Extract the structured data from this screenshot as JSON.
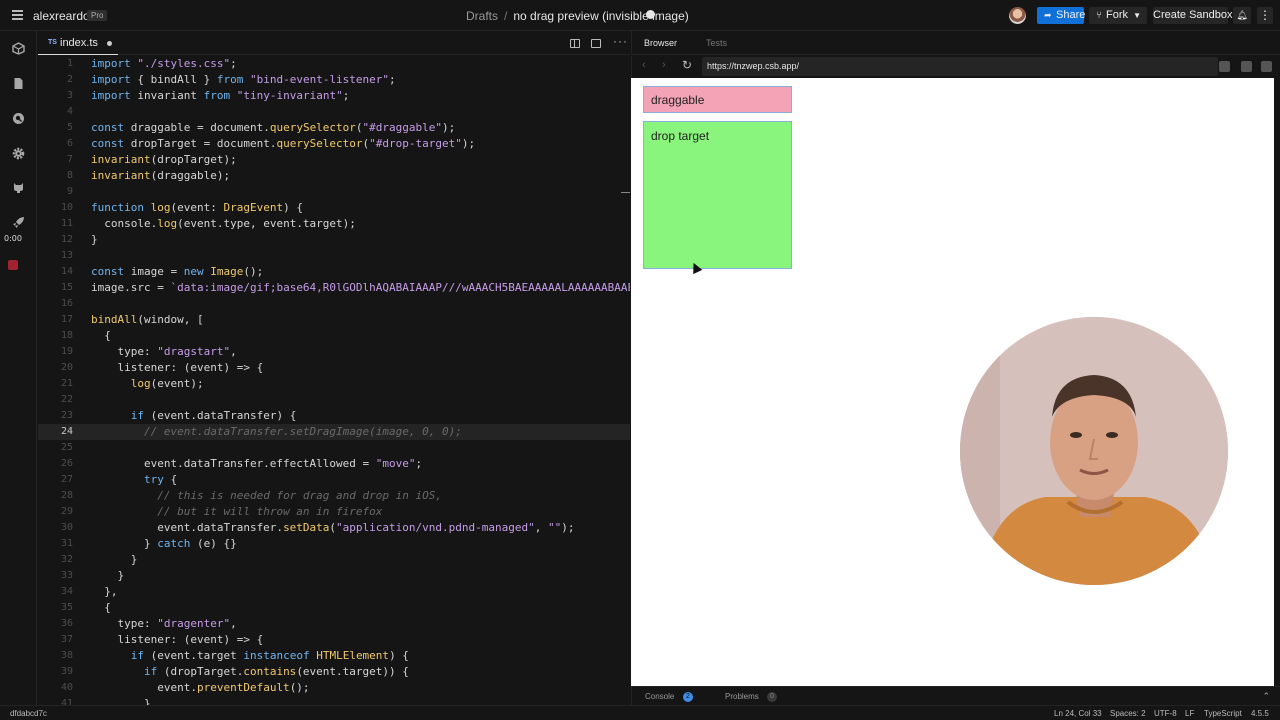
{
  "topbar": {
    "workspace": "alexreardon",
    "plan_badge": "Pro",
    "breadcrumb_root": "Drafts",
    "breadcrumb_sep": "/",
    "sandbox_title": "no drag preview (invisible image)",
    "share_label": "Share",
    "fork_label": "Fork",
    "create_label": "Create Sandbox"
  },
  "activity": {
    "icons": [
      "project-icon",
      "files-icon",
      "search-icon",
      "gear-icon",
      "github-icon",
      "deploy-icon",
      "record-icon"
    ],
    "timer": "0:00"
  },
  "editor": {
    "tab_prefix": "TS",
    "tab_name": "index.ts",
    "active_line": 24,
    "lines": [
      "import \"./styles.css\";",
      "import { bindAll } from \"bind-event-listener\";",
      "import invariant from \"tiny-invariant\";",
      "",
      "const draggable = document.querySelector(\"#draggable\");",
      "const dropTarget = document.querySelector(\"#drop-target\");",
      "invariant(dropTarget);",
      "invariant(draggable);",
      "",
      "function log(event: DragEvent) {",
      "  console.log(event.type, event.target);",
      "}",
      "",
      "const image = new Image();",
      "image.src = `data:image/gif;base64,R0lGODlhAQABAIAAAP///wAAACH5BAEAAAAALAAAAAABAAEAA",
      "",
      "bindAll(window, [",
      "  {",
      "    type: \"dragstart\",",
      "    listener: (event) => {",
      "      log(event);",
      "",
      "      if (event.dataTransfer) {",
      "        // event.dataTransfer.setDragImage(image, 0, 0);",
      "",
      "        event.dataTransfer.effectAllowed = \"move\";",
      "        try {",
      "          // this is needed for drag and drop in iOS,",
      "          // but it will throw an in firefox",
      "          event.dataTransfer.setData(\"application/vnd.pdnd-managed\", \"\");",
      "        } catch (e) {}",
      "      }",
      "    }",
      "  },",
      "  {",
      "    type: \"dragenter\",",
      "    listener: (event) => {",
      "      if (event.target instanceof HTMLElement) {",
      "        if (dropTarget.contains(event.target)) {",
      "          event.preventDefault();",
      "        }"
    ]
  },
  "browser": {
    "tab_browser": "Browser",
    "tab_tests": "Tests",
    "url": "https://tnzwep.csb.app/",
    "draggable_label": "draggable",
    "drop_target_label": "drop target",
    "colors": {
      "draggable_bg": "#f4a3b6",
      "drop_target_bg": "#8af57c",
      "border": "#86b0d8"
    }
  },
  "console": {
    "console_label": "Console",
    "console_count": "2",
    "problems_label": "Problems",
    "problems_count": "0"
  },
  "status": {
    "commit": "dfdabcd7c",
    "cursor": "Ln 24, Col 33",
    "spaces": "Spaces: 2",
    "encoding": "UTF-8",
    "eol": "LF",
    "language": "TypeScript",
    "version": "4.5.5"
  }
}
